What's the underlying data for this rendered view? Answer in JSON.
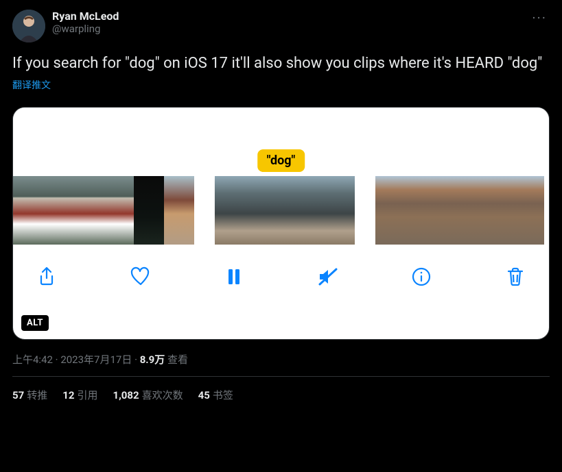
{
  "author": {
    "display_name": "Ryan McLeod",
    "handle": "@warpling"
  },
  "body_text": "If you search for \"dog\" on iOS 17 it'll also show you clips where it's HEARD \"dog\"",
  "translate_label": "翻译推文",
  "media": {
    "chip_label": "\"dog\"",
    "alt_badge": "ALT",
    "toolbar_icons": {
      "share": "share-icon",
      "like": "heart-icon",
      "pause": "pause-icon",
      "mute": "mute-icon",
      "info": "info-icon",
      "trash": "trash-icon"
    }
  },
  "meta": {
    "time": "上午4:42",
    "date": "2023年7月17日",
    "views_count": "8.9万",
    "views_label": " 查看"
  },
  "stats": {
    "retweets": {
      "count": "57",
      "label": "转推"
    },
    "quotes": {
      "count": "12",
      "label": "引用"
    },
    "likes": {
      "count": "1,082",
      "label": "喜欢次数"
    },
    "bookmarks": {
      "count": "45",
      "label": "书签"
    }
  },
  "more_button_glyph": "···"
}
